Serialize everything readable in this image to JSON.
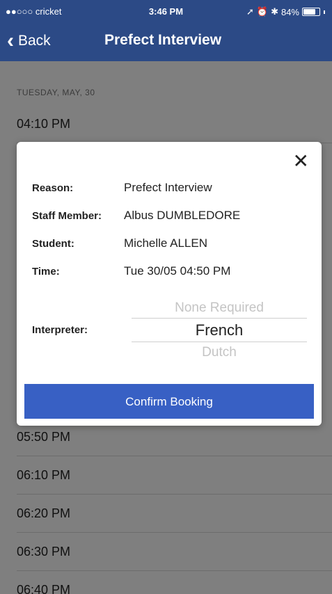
{
  "status_bar": {
    "carrier": "●●○○○ cricket",
    "time": "3:46 PM",
    "battery": "84%",
    "battery_level": 0.84
  },
  "nav": {
    "back_label": "Back",
    "title": "Prefect Interview"
  },
  "list": {
    "date_header": "TUESDAY, MAY, 30",
    "slots": [
      "04:10 PM",
      "05:50 PM",
      "06:10 PM",
      "06:20 PM",
      "06:30 PM",
      "06:40 PM"
    ]
  },
  "modal": {
    "close_icon": "close-icon",
    "details": [
      {
        "label": "Reason:",
        "value": "Prefect Interview"
      },
      {
        "label": "Staff Member:",
        "value": "Albus DUMBLEDORE"
      },
      {
        "label": "Student:",
        "value": "Michelle ALLEN"
      },
      {
        "label": "Time:",
        "value": "Tue 30/05 04:50 PM"
      }
    ],
    "interpreter_label": "Interpreter:",
    "interpreter_options": [
      "None Required",
      "French",
      "Dutch"
    ],
    "interpreter_selected": "French",
    "confirm_label": "Confirm Booking"
  },
  "colors": {
    "nav_bar": "#2c4a86",
    "confirm_button": "#3860c4",
    "overlay": "rgba(0,0,0,0.5)"
  }
}
